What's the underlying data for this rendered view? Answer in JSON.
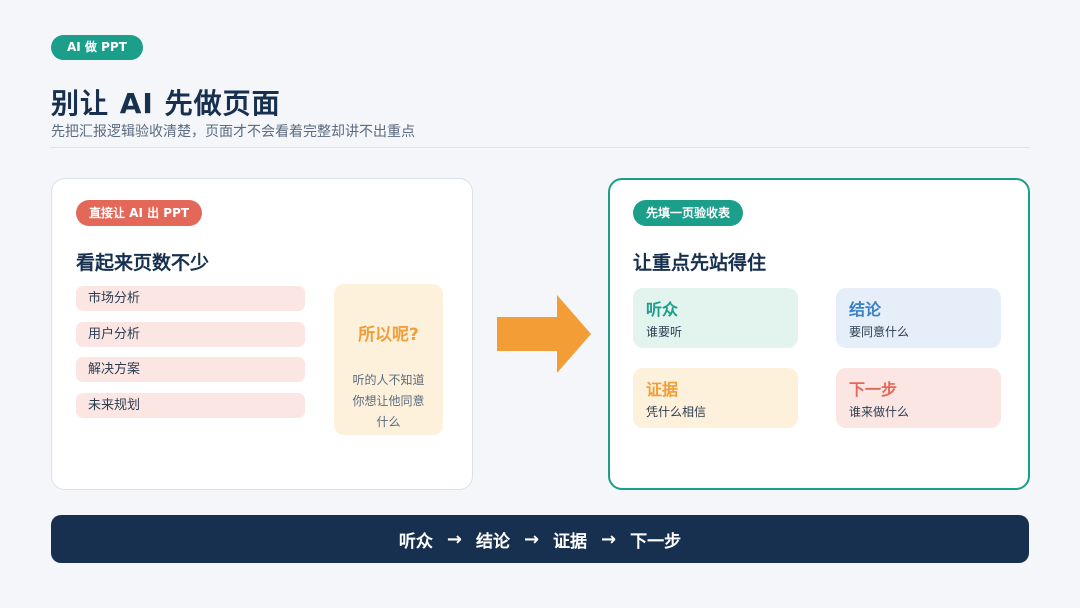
{
  "header": {
    "tag": "AI 做 PPT",
    "title": "别让 AI 先做页面",
    "subtitle": "先把汇报逻辑验收清楚，页面才不会看着完整却讲不出重点"
  },
  "left_card": {
    "tag": "直接让 AI 出 PPT",
    "title": "看起来页数不少",
    "items": [
      "市场分析",
      "用户分析",
      "解决方案",
      "未来规划"
    ],
    "note": {
      "title": "所以呢?",
      "lines": [
        "听的人不知道",
        "你想让他同意",
        "什么"
      ]
    }
  },
  "right_card": {
    "tag": "先填一页验收表",
    "title": "让重点先站得住",
    "boxes": [
      {
        "title": "听众",
        "sub": "谁要听"
      },
      {
        "title": "结论",
        "sub": "要同意什么"
      },
      {
        "title": "证据",
        "sub": "凭什么相信"
      },
      {
        "title": "下一步",
        "sub": "谁来做什么"
      }
    ]
  },
  "flow": {
    "steps": [
      "听众",
      "结论",
      "证据",
      "下一步"
    ],
    "arrow": "→"
  },
  "colors": {
    "teal": "#1b9e8a",
    "coral": "#e4685a",
    "orange": "#f09e3a",
    "navy": "#18304f",
    "blue": "#3b82c4"
  }
}
